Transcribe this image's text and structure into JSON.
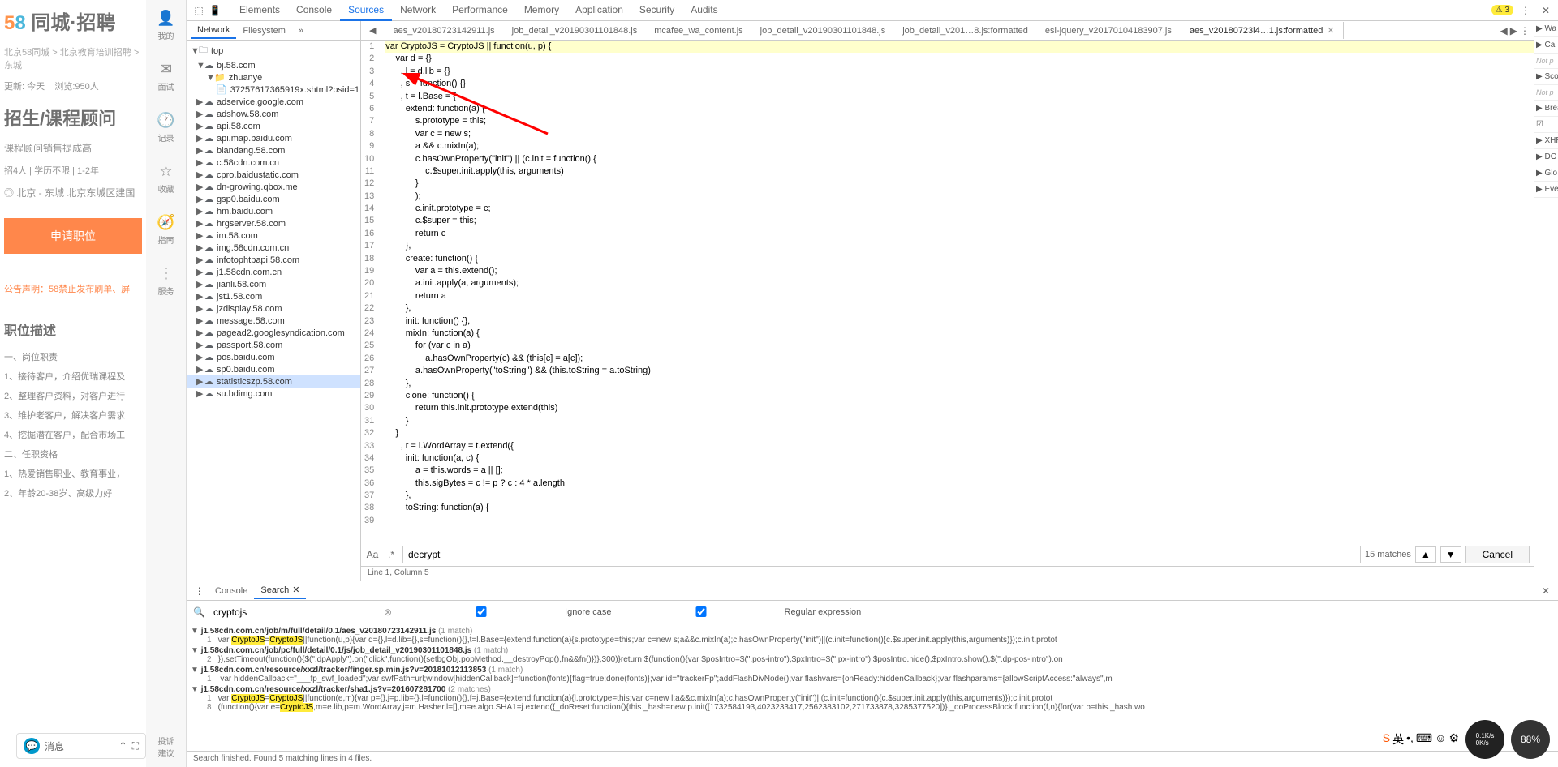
{
  "page": {
    "logo": {
      "five": "5",
      "eight": "8",
      "text": " 同城·招聘"
    },
    "breadcrumb": "北京58同城 > 北京教育培训招聘 > 东城",
    "update": "更新: 今天",
    "views": "浏览:950人",
    "apply_label": "申",
    "job_title": "招生/课程顾问",
    "subtitle": "课程顾问销售提成高",
    "tags": "招4人  |  学历不限  |  1-2年",
    "location": "◎ 北京 - 东城  北京东城区建国",
    "apply_btn": "申请职位",
    "notice": "公告声明：58禁止发布刷单、屏",
    "section": "职位描述",
    "lines": [
      "一、岗位职责",
      "1、接待客户，介绍优瑞课程及",
      "2、整理客户资料，对客户进行",
      "3、维护老客户，解决客户需求",
      "4、挖掘潜在客户，配合市场工",
      "二、任职资格",
      "1、热爱销售职业、教育事业，",
      "2、年龄20-38岁、高级力好"
    ]
  },
  "sidebar": {
    "items": [
      {
        "icon": "👤",
        "label": "我的"
      },
      {
        "icon": "✉",
        "label": "面试"
      },
      {
        "icon": "🕐",
        "label": "记录"
      },
      {
        "icon": "☆",
        "label": "收藏"
      },
      {
        "icon": "🧭",
        "label": "指南"
      },
      {
        "icon": "⋮",
        "label": "服务"
      }
    ],
    "bottom": "投诉\n建议"
  },
  "devtools": {
    "tabs": [
      "Elements",
      "Console",
      "Sources",
      "Network",
      "Performance",
      "Memory",
      "Application",
      "Security",
      "Audits"
    ],
    "active_tab": "Sources",
    "warnings": "⚠ 3",
    "src_left_tabs": [
      "Network",
      "Filesystem",
      "»"
    ],
    "src_left_active": "Network",
    "tree": [
      {
        "d": 0,
        "arrow": "▼",
        "ico": "🗀",
        "t": "top"
      },
      {
        "d": 1,
        "arrow": "▼",
        "ico": "☁",
        "t": "bj.58.com"
      },
      {
        "d": 2,
        "arrow": "▼",
        "ico": "📁",
        "t": "zhuanye"
      },
      {
        "d": 3,
        "arrow": "",
        "ico": "📄",
        "t": "37257617365919x.shtml?psid=1."
      },
      {
        "d": 1,
        "arrow": "▶",
        "ico": "☁",
        "t": "adservice.google.com"
      },
      {
        "d": 1,
        "arrow": "▶",
        "ico": "☁",
        "t": "adshow.58.com"
      },
      {
        "d": 1,
        "arrow": "▶",
        "ico": "☁",
        "t": "api.58.com"
      },
      {
        "d": 1,
        "arrow": "▶",
        "ico": "☁",
        "t": "api.map.baidu.com"
      },
      {
        "d": 1,
        "arrow": "▶",
        "ico": "☁",
        "t": "biandang.58.com"
      },
      {
        "d": 1,
        "arrow": "▶",
        "ico": "☁",
        "t": "c.58cdn.com.cn"
      },
      {
        "d": 1,
        "arrow": "▶",
        "ico": "☁",
        "t": "cpro.baidustatic.com"
      },
      {
        "d": 1,
        "arrow": "▶",
        "ico": "☁",
        "t": "dn-growing.qbox.me"
      },
      {
        "d": 1,
        "arrow": "▶",
        "ico": "☁",
        "t": "gsp0.baidu.com"
      },
      {
        "d": 1,
        "arrow": "▶",
        "ico": "☁",
        "t": "hm.baidu.com"
      },
      {
        "d": 1,
        "arrow": "▶",
        "ico": "☁",
        "t": "hrgserver.58.com"
      },
      {
        "d": 1,
        "arrow": "▶",
        "ico": "☁",
        "t": "im.58.com"
      },
      {
        "d": 1,
        "arrow": "▶",
        "ico": "☁",
        "t": "img.58cdn.com.cn"
      },
      {
        "d": 1,
        "arrow": "▶",
        "ico": "☁",
        "t": "infotophtpapi.58.com"
      },
      {
        "d": 1,
        "arrow": "▶",
        "ico": "☁",
        "t": "j1.58cdn.com.cn"
      },
      {
        "d": 1,
        "arrow": "▶",
        "ico": "☁",
        "t": "jianli.58.com"
      },
      {
        "d": 1,
        "arrow": "▶",
        "ico": "☁",
        "t": "jst1.58.com"
      },
      {
        "d": 1,
        "arrow": "▶",
        "ico": "☁",
        "t": "jzdisplay.58.com"
      },
      {
        "d": 1,
        "arrow": "▶",
        "ico": "☁",
        "t": "message.58.com"
      },
      {
        "d": 1,
        "arrow": "▶",
        "ico": "☁",
        "t": "pagead2.googlesyndication.com"
      },
      {
        "d": 1,
        "arrow": "▶",
        "ico": "☁",
        "t": "passport.58.com"
      },
      {
        "d": 1,
        "arrow": "▶",
        "ico": "☁",
        "t": "pos.baidu.com"
      },
      {
        "d": 1,
        "arrow": "▶",
        "ico": "☁",
        "t": "sp0.baidu.com"
      },
      {
        "d": 1,
        "arrow": "▶",
        "ico": "☁",
        "t": "statisticszp.58.com",
        "sel": true
      },
      {
        "d": 1,
        "arrow": "▶",
        "ico": "☁",
        "t": "su.bdimg.com"
      }
    ],
    "editor_tabs": [
      {
        "label": "◀"
      },
      {
        "label": "aes_v20180723142911.js"
      },
      {
        "label": "job_detail_v20190301101848.js"
      },
      {
        "label": "mcafee_wa_content.js"
      },
      {
        "label": "job_detail_v20190301101848.js"
      },
      {
        "label": "job_detail_v201…8.js:formatted"
      },
      {
        "label": "esl-jquery_v20170104183907.js"
      },
      {
        "label": "aes_v20180723l4…1.js:formatted",
        "active": true
      }
    ],
    "code_lines": [
      "var CryptoJS = CryptoJS || function(u, p) {",
      "    var d = {}",
      "      , l = d.lib = {}",
      "      , s = function() {}",
      "      , t = l.Base = {",
      "        extend: function(a) {",
      "            s.prototype = this;",
      "            var c = new s;",
      "            a && c.mixIn(a);",
      "            c.hasOwnProperty(\"init\") || (c.init = function() {",
      "                c.$super.init.apply(this, arguments)",
      "            }",
      "            );",
      "            c.init.prototype = c;",
      "            c.$super = this;",
      "            return c",
      "        },",
      "        create: function() {",
      "            var a = this.extend();",
      "            a.init.apply(a, arguments);",
      "            return a",
      "        },",
      "        init: function() {},",
      "        mixIn: function(a) {",
      "            for (var c in a)",
      "                a.hasOwnProperty(c) && (this[c] = a[c]);",
      "            a.hasOwnProperty(\"toString\") && (this.toString = a.toString)",
      "        },",
      "        clone: function() {",
      "            return this.init.prototype.extend(this)",
      "        }",
      "    }",
      "      , r = l.WordArray = t.extend({",
      "        init: function(a, c) {",
      "            a = this.words = a || [];",
      "            this.sigBytes = c != p ? c : 4 * a.length",
      "        },",
      "        toString: function(a) {",
      " "
    ],
    "search": {
      "value": "decrypt",
      "matches": "15 matches",
      "cancel": "Cancel"
    },
    "status_line": "Line 1, Column 5",
    "right_pane": {
      "sections": [
        "▶ Wa",
        "▶ Ca",
        "Not p",
        "▶ Sco",
        "Not p",
        "▶ Brea",
        "☑",
        "▶ XHR",
        "▶ DO",
        "▶ Glo",
        "▶ Eve"
      ]
    }
  },
  "drawer": {
    "tabs": [
      "Console",
      "Search"
    ],
    "active": "Search",
    "search_value": "cryptojs",
    "ignore_case": "Ignore case",
    "regex": "Regular expression",
    "results": [
      {
        "path": "j1.58cdn.com.cn/job/m/full/detail/0.1/aes_v20180723142911.js",
        "count": "(1 match)",
        "lines": [
          {
            "n": "1",
            "pre": "var ",
            "hl": "CryptoJS",
            "mid": "=",
            "hl2": "CryptoJS",
            "post": "||function(u,p){var d={},l=d.lib={},s=function(){},t=l.Base={extend:function(a){s.prototype=this;var c=new s;a&&c.mixIn(a);c.hasOwnProperty(\"init\")||(c.init=function(){c.$super.init.apply(this,arguments)});c.init.protot"
          }
        ]
      },
      {
        "path": "j1.58cdn.com.cn/job/pc/full/detail/0.1/js/job_detail_v20190301101848.js",
        "count": "(1 match)",
        "lines": [
          {
            "n": "2",
            "pre": "}),setTimeout(function(){$(\".dpApply\").on(\"click\",function(){setbgObj.popMethod.__destroyPop(),fn&&fn()})},300)}return $(function(){var $posIntro=$(\".pos-intro\"),$pxIntro=$(\".px-intro\");$posIntro.hide(),$pxIntro.show(),$(\".dp-pos-intro\").on"
          }
        ]
      },
      {
        "path": "j1.58cdn.com.cn/resource/xxzl/tracker/finger.sp.min.js?v=20181012113853",
        "count": "(1 match)",
        "lines": [
          {
            "n": "1",
            "pre": "    var hiddenCallback=\"___fp_swf_loaded\";var swfPath=url;window[hiddenCallback]=function(fonts){flag=true;done(fonts)};var id=\"trackerFp\";addFlashDivNode();var flashvars={onReady:hiddenCallback};var flashparams={allowScriptAccess:\"always\",m"
          }
        ]
      },
      {
        "path": "j1.58cdn.com.cn/resource/xxzl/tracker/sha1.js?v=201607281700",
        "count": "(2 matches)",
        "lines": [
          {
            "n": "1",
            "pre": "var ",
            "hl": "CryptoJS",
            "mid": "=",
            "hl2": "CryptoJS",
            "post": "||function(e,m){var p={},j=p.lib={},l=function(){},f=j.Base={extend:function(a){l.prototype=this;var c=new l;a&&c.mixIn(a);c.hasOwnProperty(\"init\")||(c.init=function(){c.$super.init.apply(this,arguments)});c.init.protot"
          },
          {
            "n": "8",
            "pre": "(function(){var e=",
            "hl": "CryptoJS",
            "post": ",m=e.lib,p=m.WordArray,j=m.Hasher,l=[],m=e.algo.SHA1=j.extend({_doReset:function(){this._hash=new p.init([1732584193,4023233417,2562383102,271733878,3285377520])},_doProcessBlock:function(f,n){for(var b=this._hash.wo"
          }
        ]
      }
    ],
    "status": "Search finished. Found 5 matching lines in 4 files."
  },
  "msg_bar": {
    "label": "消息"
  },
  "os": {
    "pct": "88%",
    "net": "0.1K/s\n0K/s"
  }
}
